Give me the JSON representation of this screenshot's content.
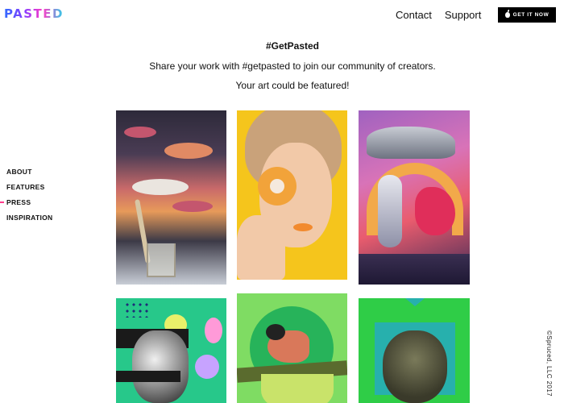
{
  "brand": {
    "logo_text": "PASTED"
  },
  "topnav": {
    "links": [
      "Contact",
      "Support"
    ],
    "cta_label": "GET IT NOW"
  },
  "hero": {
    "title": "#GetPasted",
    "line1": "Share your work with #getpasted to join our community of creators.",
    "line2": "Your art could be featured!"
  },
  "sidenav": {
    "items": [
      {
        "label": "ABOUT",
        "active": false
      },
      {
        "label": "FEATURES",
        "active": false
      },
      {
        "label": "PRESS",
        "active": true
      },
      {
        "label": "INSPIRATION",
        "active": false
      }
    ]
  },
  "gallery": {
    "tiles": [
      {
        "subject": "surreal landscape collage with clouds, road and glass"
      },
      {
        "subject": "girl holding a donut over her eye"
      },
      {
        "subject": "astronaut, flying car and creature collage"
      },
      {
        "subject": "anatomical heart collage with colorful blobs"
      },
      {
        "subject": "bullfinch on a branch over green circle"
      },
      {
        "subject": "tree collage on green background"
      }
    ]
  },
  "footer": {
    "copyright": "©Spruced, LLC 2017"
  },
  "colors": {
    "accent": "#ff3c8c",
    "cta_bg": "#000000"
  }
}
